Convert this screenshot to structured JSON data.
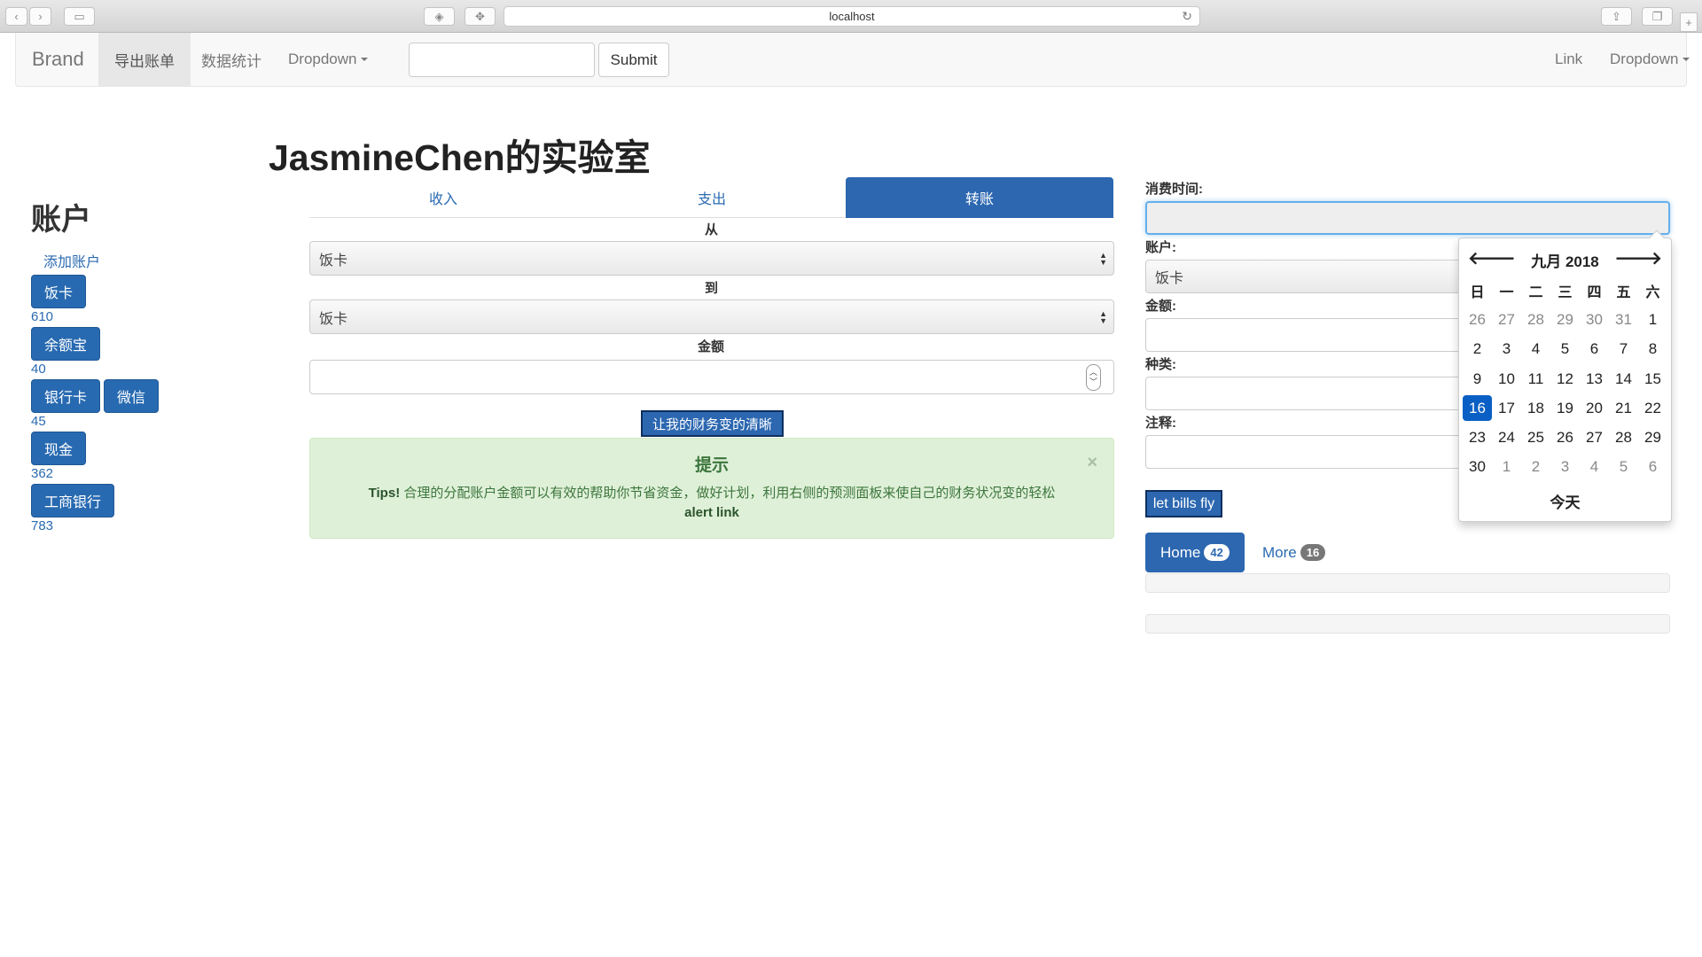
{
  "browser": {
    "url": "localhost"
  },
  "navbar": {
    "brand": "Brand",
    "items": [
      "导出账单",
      "数据统计",
      "Dropdown"
    ],
    "submit_label": "Submit",
    "right_link": "Link",
    "right_dropdown": "Dropdown"
  },
  "accounts": {
    "title": "账户",
    "add_label": "添加账户",
    "list": [
      {
        "name": "饭卡",
        "value": "610"
      },
      {
        "name": "余额宝",
        "value": "40"
      },
      {
        "name": "银行卡",
        "value": "45"
      },
      {
        "name": "微信",
        "value": ""
      },
      {
        "name": "现金",
        "value": "362"
      },
      {
        "name": "工商银行",
        "value": "783"
      }
    ]
  },
  "main": {
    "title": "JasmineChen的实验室",
    "tabs": [
      "收入",
      "支出",
      "转账"
    ],
    "from_label": "从",
    "from_value": "饭卡",
    "to_label": "到",
    "to_value": "饭卡",
    "amount_label": "金额",
    "clear_button": "让我的财务变的清晰"
  },
  "alert": {
    "title": "提示",
    "close": "×",
    "tips_bold": "Tips!",
    "text": "合理的分配账户金额可以有效的帮助你节省资金，做好计划，利用右侧的预测面板来使自己的财务状况变的轻松",
    "link": "alert link"
  },
  "right": {
    "time_label": "消费时间:",
    "account_label": "账户:",
    "account_value": "饭卡",
    "amount_label": "金额:",
    "category_label": "种类:",
    "note_label": "注释:",
    "fly_button": "let bills fly",
    "pills": [
      {
        "label": "Home",
        "badge": "42"
      },
      {
        "label": "More",
        "badge": "16"
      }
    ]
  },
  "datepicker": {
    "title": "九月 2018",
    "prev": "🡐",
    "next": "🡒",
    "dow": [
      "日",
      "一",
      "二",
      "三",
      "四",
      "五",
      "六"
    ],
    "weeks": [
      [
        "26",
        "27",
        "28",
        "29",
        "30",
        "31",
        "1"
      ],
      [
        "2",
        "3",
        "4",
        "5",
        "6",
        "7",
        "8"
      ],
      [
        "9",
        "10",
        "11",
        "12",
        "13",
        "14",
        "15"
      ],
      [
        "16",
        "17",
        "18",
        "19",
        "20",
        "21",
        "22"
      ],
      [
        "23",
        "24",
        "25",
        "26",
        "27",
        "28",
        "29"
      ],
      [
        "30",
        "1",
        "2",
        "3",
        "4",
        "5",
        "6"
      ]
    ],
    "selected": "16",
    "today_label": "今天"
  }
}
